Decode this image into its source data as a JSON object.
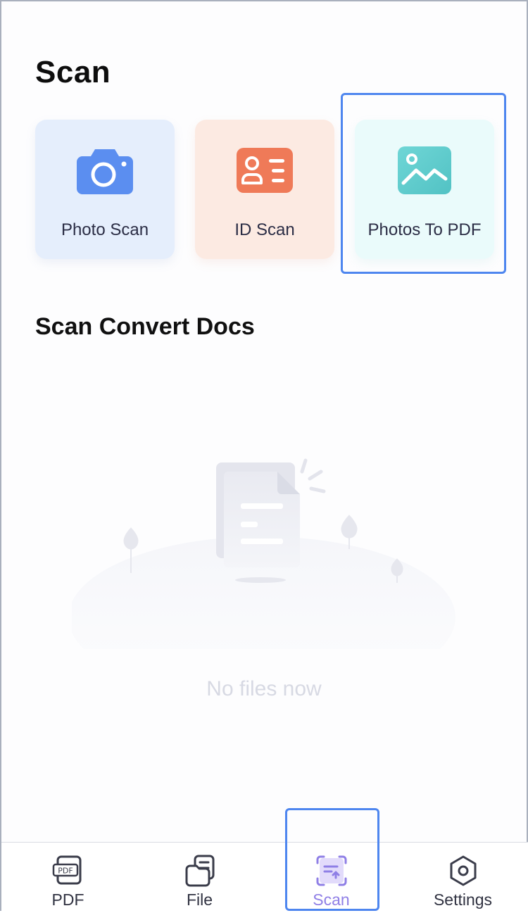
{
  "page": {
    "title": "Scan"
  },
  "tools": [
    {
      "label": "Photo Scan",
      "icon": "camera-icon",
      "color": "#5b8ef0"
    },
    {
      "label": "ID Scan",
      "icon": "id-card-icon",
      "color": "#ef7a58"
    },
    {
      "label": "Photos To PDF",
      "icon": "image-icon",
      "color": "#63d1d1"
    }
  ],
  "section": {
    "title": "Scan Convert Docs",
    "empty_text": "No files now"
  },
  "tabbar": {
    "items": [
      {
        "label": "PDF",
        "icon": "pdf-icon"
      },
      {
        "label": "File",
        "icon": "file-icon"
      },
      {
        "label": "Scan",
        "icon": "scan-icon"
      },
      {
        "label": "Settings",
        "icon": "settings-icon"
      }
    ],
    "active": "Scan",
    "active_color": "#8f7fe6"
  },
  "highlight_color": "#4e86ef"
}
